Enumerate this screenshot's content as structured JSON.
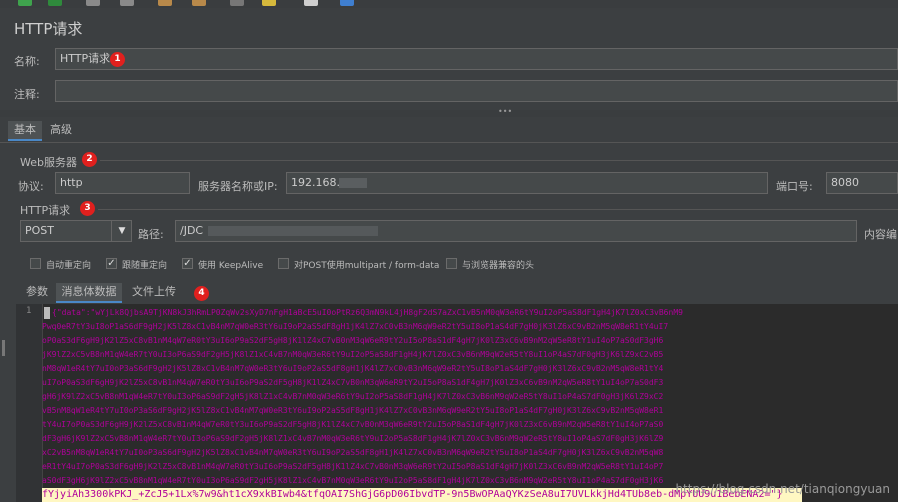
{
  "panel_title": "HTTP请求",
  "name_field": {
    "label": "名称:",
    "value": "HTTP请求"
  },
  "comment_field": {
    "label": "注释:",
    "value": ""
  },
  "splitter_dots": "•••",
  "top_tabs": [
    "基本",
    "高级"
  ],
  "web_server": {
    "section_label": "Web服务器",
    "protocol_label": "协议:",
    "protocol_value": "http",
    "server_label": "服务器名称或IP:",
    "server_value": "192.168.",
    "port_label": "端口号:",
    "port_value": "8080"
  },
  "http_request": {
    "section_label": "HTTP请求",
    "method": "POST",
    "path_label": "路径:",
    "path_value": "/JDC",
    "content_encoding_label": "内容编"
  },
  "options": [
    {
      "label": "自动重定向",
      "checked": false
    },
    {
      "label": "跟随重定向",
      "checked": true
    },
    {
      "label": "使用 KeepAlive",
      "checked": true
    },
    {
      "label": "对POST使用multipart / form-data",
      "checked": false
    },
    {
      "label": "与浏览器兼容的头",
      "checked": false
    }
  ],
  "body_tabs": [
    "参数",
    "消息体数据",
    "文件上传"
  ],
  "badges": [
    "1",
    "2",
    "3",
    "4"
  ],
  "editor": {
    "line_number": "1",
    "lines": [
      "{\"data\":\"wYjLk8QjbsA9TjKN8kJ3hRmLP0ZqWv2sXyD7nFgH1aBcE5uI0oPtRz6Q3mN9kL4jH8gF2dS7aZxC1vB5nM0qW3eR6tY9uI2oP5aS8dF1gH4jK7lZ0xC3vB6nM9",
      "Pwq0eR7tY3uI8oP1aS6dF9gH2jK5lZ8xC1vB4nM7qW0eR3tY6uI9oP2aS5dF8gH1jK4lZ7xC0vB3nM6qW9eR2tY5uI8oP1aS4dF7gH0jK3lZ6xC9vB2nM5qW8eR1tY4uI7",
      "oP0aS3dF6gH9jK2lZ5xC8vB1nM4qW7eR0tY3uI6oP9aS2dF5gH8jK1lZ4xC7vB0nM3qW6eR9tY2uI5oP8aS1dF4gH7jK0lZ3xC6vB9nM2qW5eR8tY1uI4oP7aS0dF3gH6",
      "jK9lZ2xC5vB8nM1qW4eR7tY0uI3oP6aS9dF2gH5jK8lZ1xC4vB7nM0qW3eR6tY9uI2oP5aS8dF1gH4jK7lZ0xC3vB6nM9qW2eR5tY8uI1oP4aS7dF0gH3jK6lZ9xC2vB5",
      "nM8qW1eR4tY7uI0oP3aS6dF9gH2jK5lZ8xC1vB4nM7qW0eR3tY6uI9oP2aS5dF8gH1jK4lZ7xC0vB3nM6qW9eR2tY5uI8oP1aS4dF7gH0jK3lZ6xC9vB2nM5qW8eR1tY4",
      "uI7oP0aS3dF6gH9jK2lZ5xC8vB1nM4qW7eR0tY3uI6oP9aS2dF5gH8jK1lZ4xC7vB0nM3qW6eR9tY2uI5oP8aS1dF4gH7jK0lZ3xC6vB9nM2qW5eR8tY1uI4oP7aS0dF3",
      "gH6jK9lZ2xC5vB8nM1qW4eR7tY0uI3oP6aS9dF2gH5jK8lZ1xC4vB7nM0qW3eR6tY9uI2oP5aS8dF1gH4jK7lZ0xC3vB6nM9qW2eR5tY8uI1oP4aS7dF0gH3jK6lZ9xC2",
      "vB5nM8qW1eR4tY7uI0oP3aS6dF9gH2jK5lZ8xC1vB4nM7qW0eR3tY6uI9oP2aS5dF8gH1jK4lZ7xC0vB3nM6qW9eR2tY5uI8oP1aS4dF7gH0jK3lZ6xC9vB2nM5qW8eR1",
      "tY4uI7oP0aS3dF6gH9jK2lZ5xC8vB1nM4qW7eR0tY3uI6oP9aS2dF5gH8jK1lZ4xC7vB0nM3qW6eR9tY2uI5oP8aS1dF4gH7jK0lZ3xC6vB9nM2qW5eR8tY1uI4oP7aS0",
      "dF3gH6jK9lZ2xC5vB8nM1qW4eR7tY0uI3oP6aS9dF2gH5jK8lZ1xC4vB7nM0qW3eR6tY9uI2oP5aS8dF1gH4jK7lZ0xC3vB6nM9qW2eR5tY8uI1oP4aS7dF0gH3jK6lZ9",
      "xC2vB5nM8qW1eR4tY7uI0oP3aS6dF9gH2jK5lZ8xC1vB4nM7qW0eR3tY6uI9oP2aS5dF8gH1jK4lZ7xC0vB3nM6qW9eR2tY5uI8oP1aS4dF7gH0jK3lZ6xC9vB2nM5qW8",
      "eR1tY4uI7oP0aS3dF6gH9jK2lZ5xC8vB1nM4qW7eR0tY3uI6oP9aS2dF5gH8jK1lZ4xC7vB0nM3qW6eR9tY2uI5oP8aS1dF4gH7jK0lZ3xC6vB9nM2qW5eR8tY1uI4oP7",
      "aS0dF3gH6jK9lZ2xC5vB8nM1qW4eR7tY0uI3oP6aS9dF2gH5jK8lZ1xC4vB7nM0qW3eR6tY9uI2oP5aS8dF1gH4jK7lZ0xC3vB6nM9qW2eR5tY8uI1oP4aS7dF0gH3jK6"
    ],
    "last_line": "fYjyiAh3300kPKJ_+ZcJ5+1Lx%7w9&ht1cX9xkBIwb4&tfqOAI7ShGjG6pD06IbvdTP-9n5BwOPAaQYKzSeA8uI7UVLkkjHd4TUb8eb-dMpYUU9u1BebENA2=\"}"
  },
  "watermark": "https://blog.csdn.net/tianqiongyuan"
}
